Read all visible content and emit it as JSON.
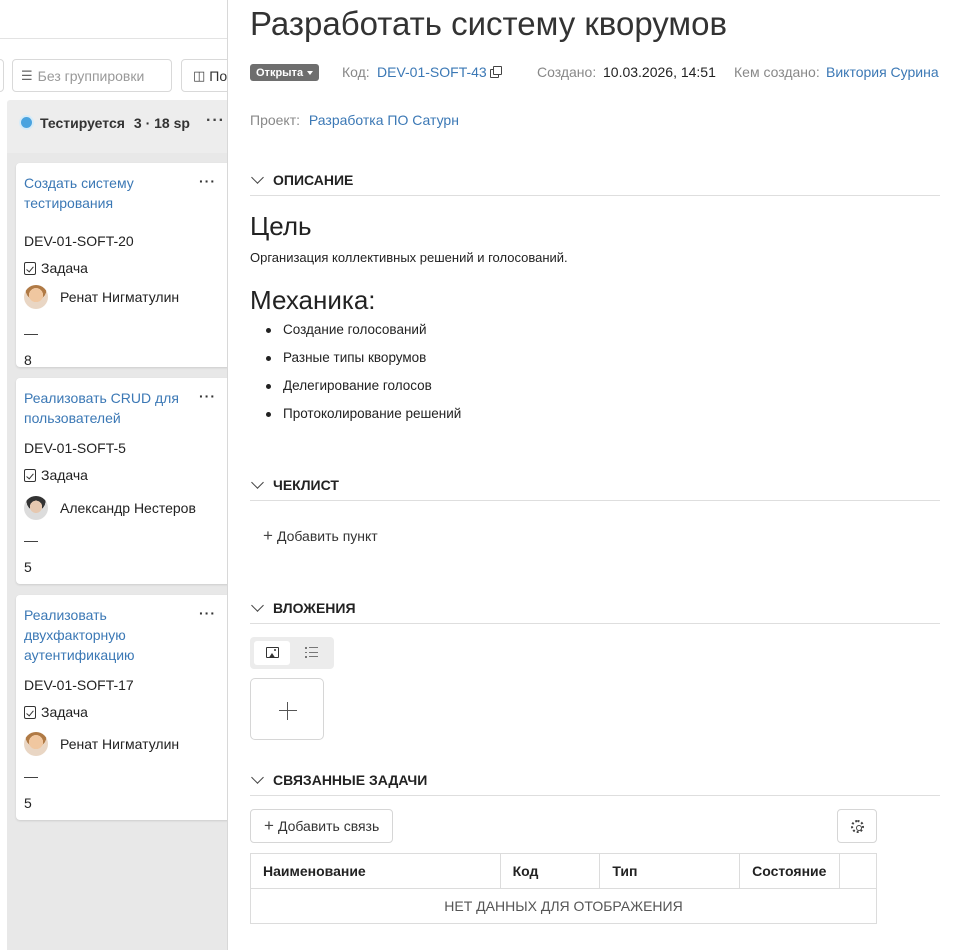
{
  "board": {
    "toolbar": {
      "group_placeholder": "Без группировки",
      "view_label": "По"
    },
    "column": {
      "title": "Тестируется",
      "count": "3 · 18 sp",
      "more": "···"
    },
    "cards": [
      {
        "title": "Создать систему тестирования",
        "code": "DEV-01-SOFT-20",
        "type": "Задача",
        "assignee": "Ренат Нигматулин",
        "dash": "—",
        "points": "8",
        "more": "···"
      },
      {
        "title": "Реализовать CRUD для пользователей",
        "code": "DEV-01-SOFT-5",
        "type": "Задача",
        "assignee": "Александр Нестеров",
        "dash": "—",
        "points": "5",
        "more": "···"
      },
      {
        "title": "Реализовать двухфакторную аутентификацию",
        "code": "DEV-01-SOFT-17",
        "type": "Задача",
        "assignee": "Ренат Нигматулин",
        "dash": "—",
        "points": "5",
        "more": "···"
      }
    ]
  },
  "task": {
    "title": "Разработать систему кворумов",
    "status": "Открыта",
    "code_label": "Код:",
    "code": "DEV-01-SOFT-43",
    "created_label": "Создано:",
    "created": "10.03.2026, 14:51",
    "author_label": "Кем создано:",
    "author": "Виктория Сурина",
    "project_label": "Проект:",
    "project": "Разработка ПО Сатурн"
  },
  "sections": {
    "description": "Описание",
    "checklist": "Чеклист",
    "attachments": "Вложения",
    "related": "Связанные задачи"
  },
  "description": {
    "goal_heading": "Цель",
    "goal_text": "Организация коллективных решений и голосований.",
    "mechanics_heading": "Механика:",
    "items": [
      "Создание голосований",
      "Разные типы кворумов",
      "Делегирование голосов",
      "Протоколирование решений"
    ]
  },
  "checklist": {
    "add_label": "Добавить пункт"
  },
  "related": {
    "add_label": "Добавить связь",
    "columns": [
      "Наименование",
      "Код",
      "Тип",
      "Состояние"
    ],
    "empty": "НЕТ ДАННЫХ ДЛЯ ОТОБРАЖЕНИЯ"
  },
  "icons": {
    "group": "list-icon",
    "view": "columns-icon",
    "copy": "copy-icon",
    "task_type": "checkbox-icon",
    "settings": "gear-icon",
    "gallery": "image-icon",
    "list_view": "list-icon",
    "add": "plus-icon"
  },
  "colors": {
    "link": "#3b78b5",
    "status_badge": "#6e6e6e",
    "column_dot": "#4aa3df"
  }
}
